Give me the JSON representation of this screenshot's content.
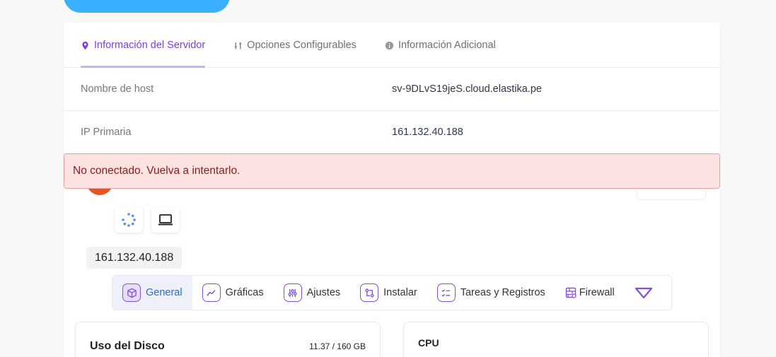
{
  "tabs": [
    {
      "label": "Información del Servidor",
      "icon": "location-pin-icon",
      "active": true
    },
    {
      "label": "Opciones Configurables",
      "icon": "sliders-icon",
      "active": false
    },
    {
      "label": "Información Adicional",
      "icon": "info-circle-icon",
      "active": false
    }
  ],
  "info": {
    "hostname_label": "Nombre de host",
    "hostname_value": "sv-9DLvS19jeS.cloud.elastika.pe",
    "ip_label": "IP Primaria",
    "ip_value": "161.132.40.188"
  },
  "alert": {
    "message": "No conectado. Vuelva a intentarlo."
  },
  "server": {
    "ip_chip": "161.132.40.188"
  },
  "nav": [
    {
      "label": "General",
      "icon": "cube-icon",
      "active": true
    },
    {
      "label": "Gráficas",
      "icon": "trend-line-icon",
      "active": false
    },
    {
      "label": "Ajustes",
      "icon": "adjustments-icon",
      "active": false
    },
    {
      "label": "Instalar",
      "icon": "git-compare-icon",
      "active": false
    },
    {
      "label": "Tareas y Registros",
      "icon": "checklist-icon",
      "active": false
    },
    {
      "label": "Firewall",
      "icon": "firewall-icon",
      "active": false
    }
  ],
  "panels": {
    "disk_title": "Uso del Disco",
    "disk_usage": "11.37 / 160 GB",
    "cpu_title": "CPU"
  },
  "colors": {
    "accent": "#7b3fe4",
    "active_nav_text": "#1e6fd9",
    "alert_bg": "#fde2e2",
    "alert_text": "#8e1b1b"
  }
}
